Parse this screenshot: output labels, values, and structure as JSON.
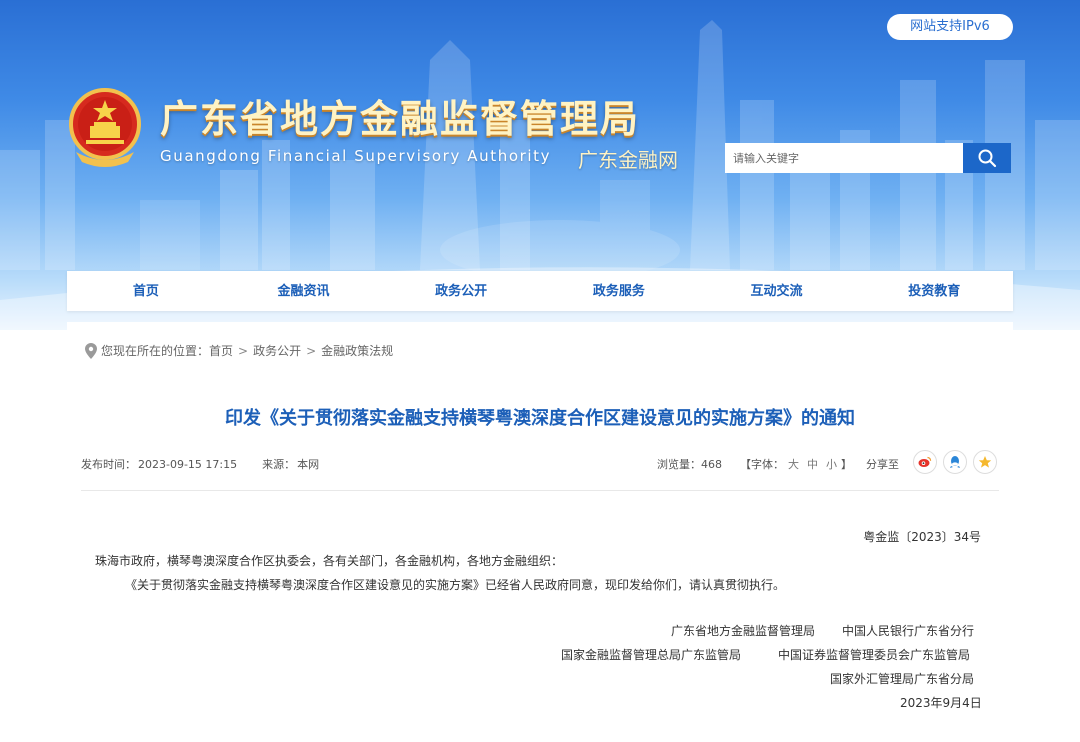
{
  "header": {
    "ipv6_label": "网站支持IPv6",
    "title": "广东省地方金融监督管理局",
    "subtitle_en": "Guangdong Financial Supervisory Authority",
    "subtitle_cn": "广东金融网",
    "search_placeholder": "请输入关键字",
    "search_icon": "search-icon"
  },
  "nav": {
    "items": [
      "首页",
      "金融资讯",
      "政务公开",
      "政务服务",
      "互动交流",
      "投资教育"
    ]
  },
  "breadcrumb": {
    "prefix": "您现在所在的位置：",
    "items": [
      "首页",
      "政务公开",
      "金融政策法规"
    ],
    "separator": ">"
  },
  "article": {
    "title": "印发《关于贯彻落实金融支持横琴粤澳深度合作区建设意见的实施方案》的通知",
    "publish_label": "发布时间：",
    "publish_time": "2023-09-15 17:15",
    "source_label": "来源：",
    "source": "本网",
    "views_label": "浏览量：",
    "views": "468",
    "font_label": "【字体：",
    "font_sizes": [
      "大",
      "中",
      "小"
    ],
    "font_close": "】",
    "share_label": "分享至",
    "share_icons": [
      "weibo-icon",
      "qq-icon",
      "qzone-icon"
    ],
    "doc_number": "粤金监〔2023〕34号",
    "salutation": "珠海市政府，横琴粤澳深度合作区执委会，各有关部门，各金融机构，各地方金融组织：",
    "body": "《关于贯彻落实金融支持横琴粤澳深度合作区建设意见的实施方案》已经省人民政府同意，现印发给你们，请认真贯彻执行。",
    "signatories": [
      "广东省地方金融监督管理局",
      "中国人民银行广东省分行",
      "国家金融监督管理总局广东监管局",
      "中国证券监督管理委员会广东监管局",
      "国家外汇管理局广东省分局"
    ],
    "date": "2023年9月4日"
  },
  "colors": {
    "primary": "#1c5fb8",
    "search_button": "#1c67c9",
    "title_gold": "#fff3c4"
  }
}
